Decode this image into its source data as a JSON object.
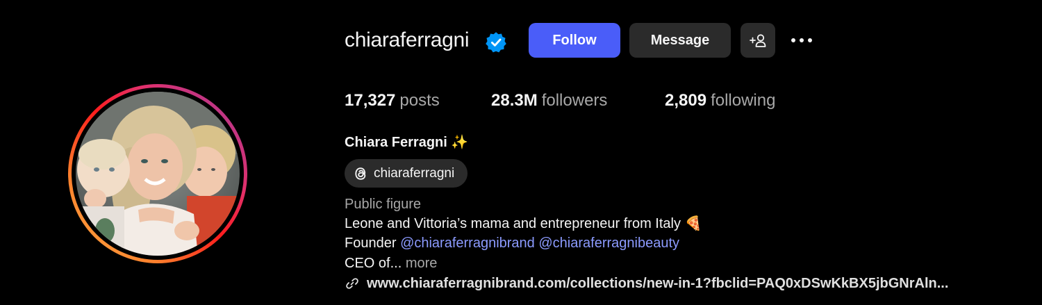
{
  "profile": {
    "username": "chiaraferragni",
    "verified": true,
    "avatar_alt": "profile-photo"
  },
  "actions": {
    "follow_label": "Follow",
    "message_label": "Message",
    "suggest_icon": "add-person-icon",
    "more_icon": "more-horizontal-icon"
  },
  "stats": [
    {
      "value": "17,327",
      "label": "posts"
    },
    {
      "value": "28.3M",
      "label": "followers"
    },
    {
      "value": "2,809",
      "label": "following"
    }
  ],
  "bio": {
    "full_name": "Chiara Ferragni",
    "full_name_emoji": "✨",
    "threads_handle": "chiaraferragni",
    "category": "Public figure",
    "line1": "Leone and Vittoria’s mama and entrepreneur from Italy",
    "line1_emoji": "🍕",
    "line2_prefix": "Founder",
    "mention1": "@chiaraferragnibrand",
    "mention2": "@chiaraferragnibeauty",
    "line3": "CEO of...",
    "more_label": "more",
    "link": "www.chiaraferragnibrand.com/collections/new-in-1?fbclid=PAQ0xDSwKkBX5jbGNrAln..."
  },
  "colors": {
    "background": "#000000",
    "follow_button": "#4a5df9",
    "secondary_button": "#2b2b2b",
    "mention": "#8c9bff",
    "muted_text": "#a8a8a8",
    "verified_badge": "#0095f6"
  }
}
